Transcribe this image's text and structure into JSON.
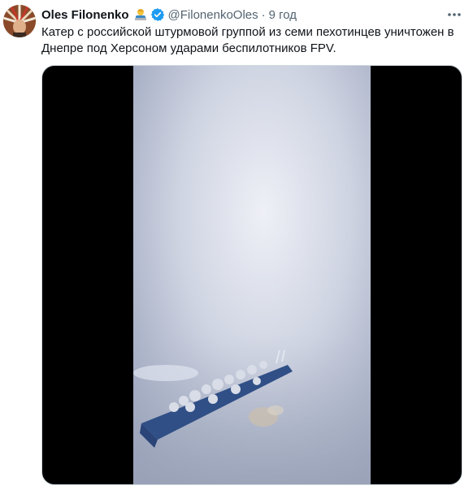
{
  "author": {
    "name": "Oles Filonenko",
    "handle": "@FilonenkoOles",
    "separator": "·",
    "time": "9 год",
    "badge_emoji": "man-technologist-emoji",
    "verified_icon": "verified-badge-icon",
    "verified_color": "#1d9bf0"
  },
  "tweet": {
    "text": "Катер с российской штурмовой группой из семи пехотинцев уничтожен в Днепре под Херсоном ударами беспилотников FPV."
  },
  "media": {
    "type": "video",
    "description_icon": "boat-video-frame"
  },
  "menu_icon": "more-horizontal-icon"
}
